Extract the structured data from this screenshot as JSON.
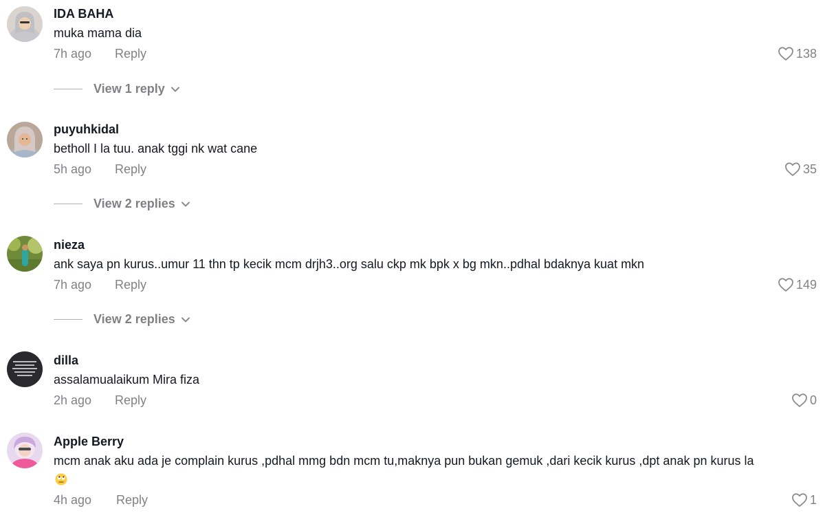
{
  "comments": [
    {
      "username": "IDA BAHA",
      "text": "muka mama dia",
      "time": "7h ago",
      "reply_label": "Reply",
      "likes": "138",
      "view_replies": "View 1 reply"
    },
    {
      "username": "puyuhkidal",
      "text": "betholl I la tuu. anak tggi nk wat cane",
      "time": "5h ago",
      "reply_label": "Reply",
      "likes": "35",
      "view_replies": "View 2 replies"
    },
    {
      "username": "nieza",
      "text": "ank saya pn kurus..umur 11 thn tp kecik mcm drjh3..org salu ckp mk bpk x bg mkn..pdhal bdaknya kuat mkn",
      "time": "7h ago",
      "reply_label": "Reply",
      "likes": "149",
      "view_replies": "View 2 replies"
    },
    {
      "username": "dilla",
      "text": "assalamualaikum Mira fiza",
      "time": "2h ago",
      "reply_label": "Reply",
      "likes": "0"
    },
    {
      "username": "Apple Berry",
      "text": "mcm anak aku ada je complain kurus ,pdhal mmg bdn mcm tu,maknya pun bukan gemuk ,dari kecik kurus ,dpt anak pn kurus la",
      "emoji": "eye-roll-emoji",
      "time": "4h ago",
      "reply_label": "Reply",
      "likes": "1"
    }
  ],
  "colors": {
    "text_primary": "#161823",
    "text_secondary": "#8a8b91",
    "heart_outline": "#8a8b91"
  }
}
